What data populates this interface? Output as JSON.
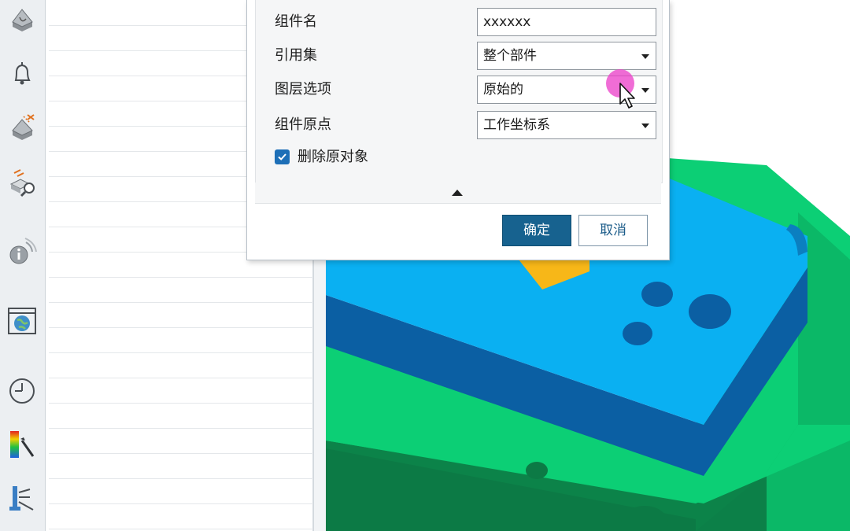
{
  "toolbar": {
    "items": [
      {
        "icon": "part-navigator-icon"
      },
      {
        "icon": "notification-bell-icon"
      },
      {
        "icon": "assembly-constraint-icon"
      },
      {
        "icon": "view-inspect-icon"
      },
      {
        "icon": "info-wireless-icon"
      },
      {
        "icon": "globe-browser-icon"
      },
      {
        "icon": "history-clock-icon"
      },
      {
        "icon": "color-palette-icon"
      },
      {
        "icon": "tool-fixture-icon"
      }
    ]
  },
  "dialog": {
    "component_name": {
      "label": "组件名",
      "value": "xxxxxx"
    },
    "reference_set": {
      "label": "引用集",
      "value": "整个部件"
    },
    "layer_option": {
      "label": "图层选项",
      "value": "原始的"
    },
    "component_origin": {
      "label": "组件原点",
      "value": "工作坐标系"
    },
    "delete_original": {
      "label": "删除原对象",
      "checked": true
    },
    "ok_label": "确定",
    "cancel_label": "取消"
  },
  "colors": {
    "accent": "#17628f",
    "plate_top": "#0ab0f2",
    "plate_side": "#0b5fa3",
    "base_green": "#0ccf75",
    "base_dark": "#0c7a45",
    "cursor_highlight": "#eb3cc8"
  }
}
